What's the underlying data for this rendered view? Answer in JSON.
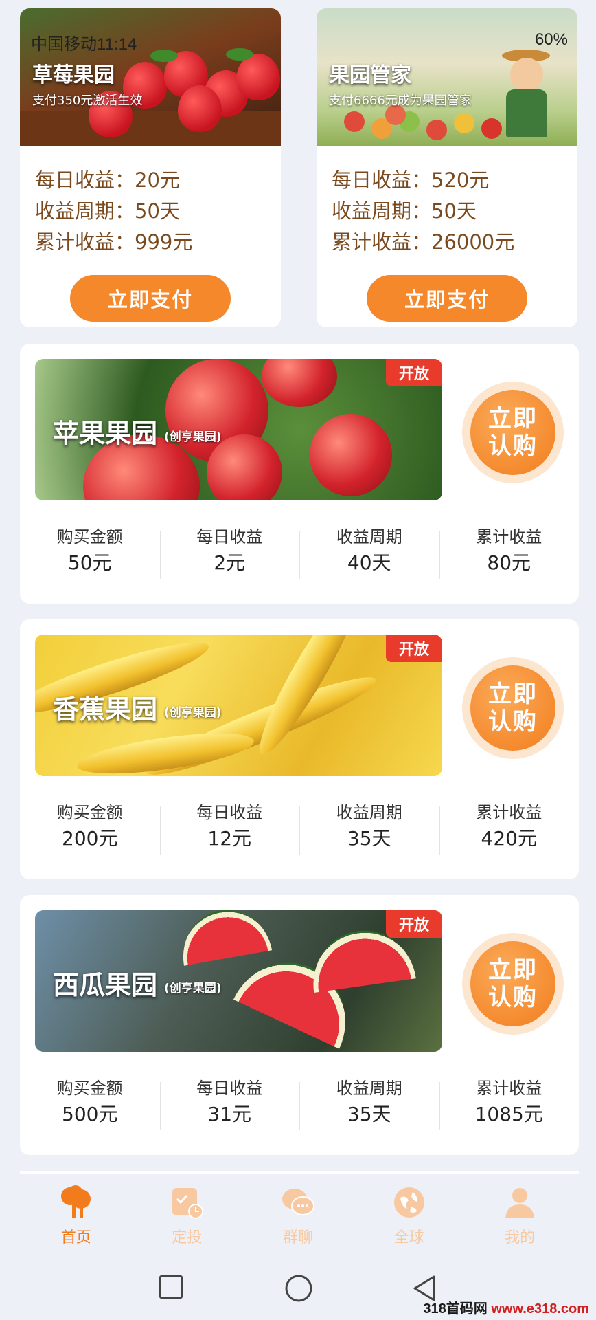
{
  "status_bar": {
    "carrier_time": "中国移动11:14",
    "battery": "60%"
  },
  "top_cards": [
    {
      "title": "草莓果园",
      "subtitle": "支付350元激活生效",
      "daily": "每日收益：20元",
      "period": "收益周期：50天",
      "total": "累计收益：999元",
      "button": "立即支付"
    },
    {
      "title": "果园管家",
      "subtitle": "支付6666元成为果园管家",
      "daily": "每日收益：520元",
      "period": "收益周期：50天",
      "total": "累计收益：26000元",
      "button": "立即支付"
    }
  ],
  "orchards": [
    {
      "name": "苹果果园",
      "tag": "(创亨果园)",
      "badge": "开放",
      "button": "立即认购",
      "stats": [
        {
          "label": "购买金额",
          "value": "50元"
        },
        {
          "label": "每日收益",
          "value": "2元"
        },
        {
          "label": "收益周期",
          "value": "40天"
        },
        {
          "label": "累计收益",
          "value": "80元"
        }
      ]
    },
    {
      "name": "香蕉果园",
      "tag": "(创亨果园)",
      "badge": "开放",
      "button": "立即认购",
      "stats": [
        {
          "label": "购买金额",
          "value": "200元"
        },
        {
          "label": "每日收益",
          "value": "12元"
        },
        {
          "label": "收益周期",
          "value": "35天"
        },
        {
          "label": "累计收益",
          "value": "420元"
        }
      ]
    },
    {
      "name": "西瓜果园",
      "tag": "(创亨果园)",
      "badge": "开放",
      "button": "立即认购",
      "stats": [
        {
          "label": "购买金额",
          "value": "500元"
        },
        {
          "label": "每日收益",
          "value": "31元"
        },
        {
          "label": "收益周期",
          "value": "35天"
        },
        {
          "label": "累计收益",
          "value": "1085元"
        }
      ]
    }
  ],
  "nav": [
    {
      "label": "首页",
      "icon": "tree-icon",
      "active": true
    },
    {
      "label": "定投",
      "icon": "schedule-icon",
      "active": false
    },
    {
      "label": "群聊",
      "icon": "chat-icon",
      "active": false
    },
    {
      "label": "全球",
      "icon": "globe-icon",
      "active": false
    },
    {
      "label": "我的",
      "icon": "user-icon",
      "active": false
    }
  ],
  "watermark": {
    "site": "318首码网",
    "url": "www.e318.com"
  },
  "colors": {
    "accent": "#f27c1c",
    "badge": "#e83b2c",
    "income_text": "#7a4a1e",
    "page_bg": "#eef0f7"
  }
}
